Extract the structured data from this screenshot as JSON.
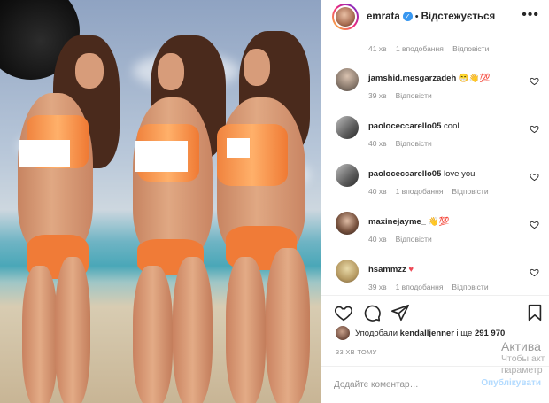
{
  "header": {
    "username": "emrata",
    "separator": "•",
    "follow_label": "Відстежується",
    "more_icon": "more-horizontal-icon"
  },
  "clipped_comment": {
    "time": "41 хв",
    "likes": "1 вподобання",
    "reply": "Відповісти"
  },
  "comments": [
    {
      "username": "jamshid.mesgarzadeh",
      "text": "😁👋💯",
      "time": "39 хв",
      "likes": "",
      "reply": "Відповісти"
    },
    {
      "username": "paoloceccarello05",
      "text": "cool",
      "time": "40 хв",
      "likes": "",
      "reply": "Відповісти"
    },
    {
      "username": "paoloceccarello05",
      "text": "love you",
      "time": "40 хв",
      "likes": "1 вподобання",
      "reply": "Відповісти"
    },
    {
      "username": "maxinejayme_",
      "text": "👋💯",
      "time": "40 хв",
      "likes": "",
      "reply": "Відповісти"
    },
    {
      "username": "hsammzz",
      "text": "♥",
      "time": "39 хв",
      "likes": "1 вподобання",
      "reply": "Відповісти"
    }
  ],
  "likes": {
    "prefix": "Уподобали",
    "user": "kendalljenner",
    "connector": "і ще",
    "count": "291 970"
  },
  "posted_ago": "33 ХВ ТОМУ",
  "composer": {
    "placeholder": "Додайте коментар…",
    "publish_label": "Опублікувати"
  },
  "watermark": {
    "line1": "Актива",
    "line2": "Чтобы акт",
    "line3": "параметр"
  },
  "colors": {
    "accent": "#3897f0",
    "publish_disabled": "#b3dbff",
    "heart_red": "#ed4956"
  }
}
